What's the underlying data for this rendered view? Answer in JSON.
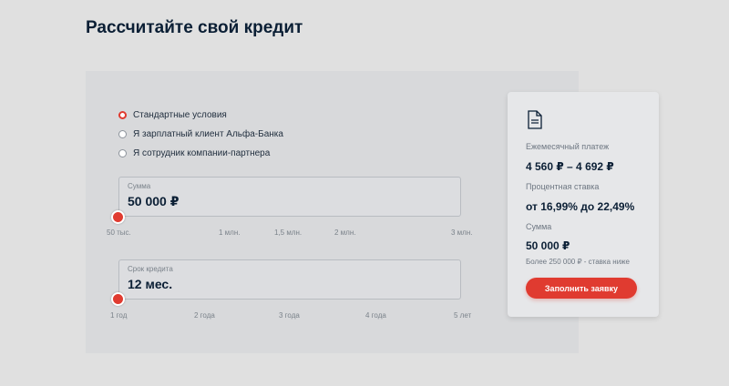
{
  "page_title": "Рассчитайте свой кредит",
  "options": [
    {
      "label": "Стандартные условия",
      "checked": true
    },
    {
      "label": "Я зарплатный клиент Альфа-Банка",
      "checked": false
    },
    {
      "label": "Я сотрудник компании-партнера",
      "checked": false
    }
  ],
  "amount": {
    "label": "Сумма",
    "value": "50 000 ₽",
    "ticks": [
      "50 тыс.",
      "1 млн.",
      "1,5 млн.",
      "2 млн.",
      "3 млн."
    ]
  },
  "term": {
    "label": "Срок кредита",
    "value": "12 мес.",
    "ticks": [
      "1 год",
      "2 года",
      "3 года",
      "4 года",
      "5 лет"
    ]
  },
  "summary": {
    "payment_label": "Ежемесячный платеж",
    "payment_value": "4 560 ₽ – 4 692 ₽",
    "rate_label": "Процентная ставка",
    "rate_value": "от 16,99% до 22,49%",
    "sum_label": "Сумма",
    "sum_value": "50 000 ₽",
    "sum_note": "Более 250 000 ₽ - ставка ниже",
    "button_label": "Заполнить заявку"
  },
  "colors": {
    "accent": "#e03b30",
    "text": "#0b1f35"
  },
  "icons": {
    "summary": "document-icon"
  }
}
